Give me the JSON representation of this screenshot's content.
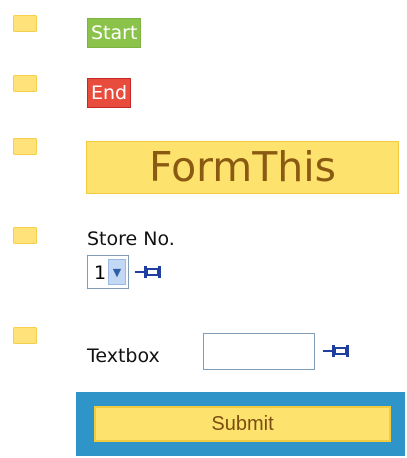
{
  "items": {
    "start_label": "Start",
    "end_label": "End",
    "form_title": "FormThis"
  },
  "fields": {
    "store": {
      "label": "Store No.",
      "selected_value": "1"
    },
    "textbox": {
      "label": "Textbox",
      "value": ""
    }
  },
  "actions": {
    "submit_label": "Submit"
  },
  "icons": {
    "pin": "pushpin-icon",
    "bullet": "square-bullet-icon"
  },
  "colors": {
    "bullet": "#ffe37a",
    "start_bg": "#8bc34a",
    "end_bg": "#e74c3c",
    "title_bg": "#fde36d",
    "submit_frame": "#2f95c9"
  }
}
